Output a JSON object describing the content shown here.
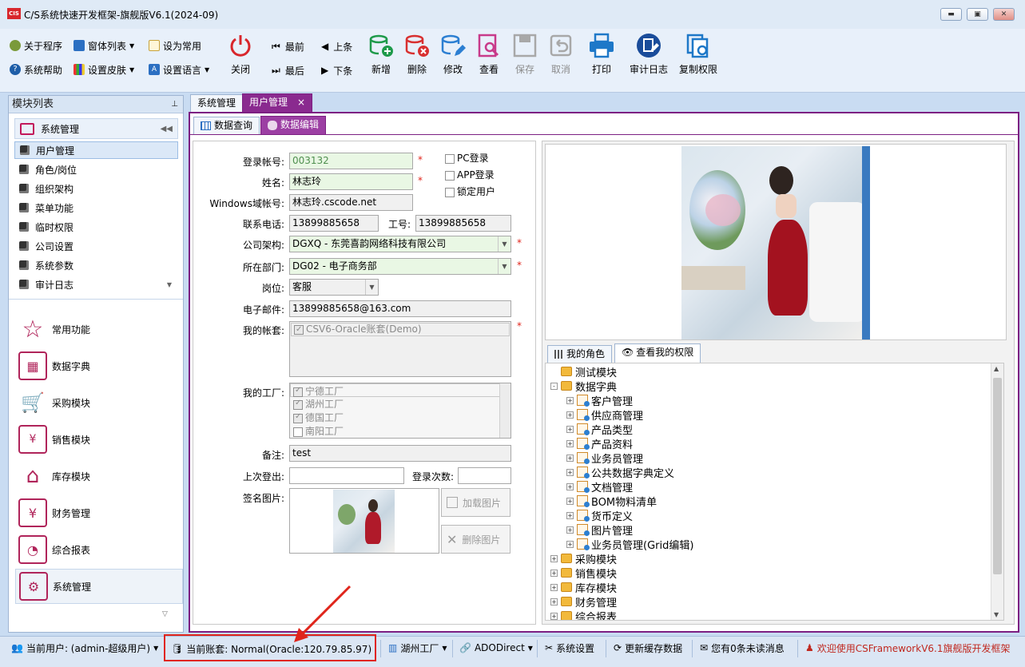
{
  "window": {
    "title": "C/S系统快速开发框架-旗舰版V6.1(2024-09)",
    "logo_text": "CIS"
  },
  "ribbon": {
    "small_buttons": [
      {
        "label": "关于程序",
        "icon": "about-icon"
      },
      {
        "label": "窗体列表",
        "icon": "windows-icon"
      },
      {
        "label": "设为常用",
        "icon": "pin-icon"
      },
      {
        "label": "系统帮助",
        "icon": "help-icon"
      },
      {
        "label": "设置皮肤",
        "icon": "skin-icon"
      },
      {
        "label": "设置语言",
        "icon": "language-icon"
      }
    ],
    "close_label": "关闭",
    "nav": {
      "first": "最前",
      "prev": "上条",
      "last": "最后",
      "next": "下条"
    },
    "big_buttons": [
      {
        "label": "新增",
        "icon": "add-db-icon",
        "color": "#1e9a4a"
      },
      {
        "label": "删除",
        "icon": "delete-db-icon",
        "color": "#d83030"
      },
      {
        "label": "修改",
        "icon": "edit-db-icon",
        "color": "#2c7fd2"
      },
      {
        "label": "查看",
        "icon": "view-doc-icon",
        "color": "#c83a8a"
      },
      {
        "label": "保存",
        "icon": "save-icon",
        "color": "#a0a0a0"
      },
      {
        "label": "取消",
        "icon": "undo-icon",
        "color": "#a0a0a0"
      },
      {
        "label": "打印",
        "icon": "print-icon",
        "color": "#1e78c8"
      },
      {
        "label": "审计日志",
        "icon": "audit-icon",
        "color": "#1a4c9a"
      },
      {
        "label": "复制权限",
        "icon": "copy-perm-icon",
        "color": "#1e78c8"
      }
    ]
  },
  "left_panel": {
    "title": "模块列表",
    "group_title": "系统管理",
    "items": [
      "用户管理",
      "角色/岗位",
      "组织架构",
      "菜单功能",
      "临时权限",
      "公司设置",
      "系统参数",
      "审计日志"
    ],
    "modules": [
      {
        "label": "常用功能",
        "icon": "star-icon"
      },
      {
        "label": "数据字典",
        "icon": "dictionary-icon"
      },
      {
        "label": "采购模块",
        "icon": "cart-icon"
      },
      {
        "label": "销售模块",
        "icon": "sales-bag-icon"
      },
      {
        "label": "库存模块",
        "icon": "warehouse-icon"
      },
      {
        "label": "财务管理",
        "icon": "finance-icon"
      },
      {
        "label": "综合报表",
        "icon": "report-icon"
      },
      {
        "label": "系统管理",
        "icon": "system-admin-icon"
      }
    ]
  },
  "tabs": {
    "system": "系统管理",
    "user": "用户管理",
    "close": "×",
    "sub_query": "数据查询",
    "sub_edit": "数据编辑"
  },
  "form": {
    "login_label": "登录帐号:",
    "login_value": "003132",
    "name_label": "姓名:",
    "name_value": "林志玲",
    "windows_label": "Windows域帐号:",
    "windows_value": "林志玲.cscode.net",
    "phone_label": "联系电话:",
    "phone_value": "13899885658",
    "empno_label": "工号:",
    "empno_value": "13899885658",
    "company_label": "公司架构:",
    "company_value": "DGXQ - 东莞喜韵网络科技有限公司",
    "dept_label": "所在部门:",
    "dept_value": "DG02 - 电子商务部",
    "post_label": "岗位:",
    "post_value": "客服",
    "email_label": "电子邮件:",
    "email_value": "13899885658@163.com",
    "account_label": "我的帐套:",
    "account_value": "CSV6-Oracle账套(Demo)",
    "factory_label": "我的工厂:",
    "factories": [
      {
        "label": "宁德工厂",
        "checked": true
      },
      {
        "label": "湖州工厂",
        "checked": true
      },
      {
        "label": "德国工厂",
        "checked": true
      },
      {
        "label": "南阳工厂",
        "checked": false
      }
    ],
    "remark_label": "备注:",
    "remark_value": "test",
    "lastlogout_label": "上次登出:",
    "lastlogout_value": "",
    "logincount_label": "登录次数:",
    "logincount_value": "",
    "sign_label": "签名图片:",
    "load_image": "加载图片",
    "delete_image": "删除图片",
    "pc_login": "PC登录",
    "app_login": "APP登录",
    "lock_user": "锁定用户",
    "required_mark": "*"
  },
  "perm_tabs": {
    "roles": "我的角色",
    "perms": "查看我的权限"
  },
  "permissions": [
    {
      "label": "测试模块",
      "level": 0,
      "type": "box",
      "fold": ""
    },
    {
      "label": "数据字典",
      "level": 0,
      "type": "box",
      "fold": "-"
    },
    {
      "label": "客户管理",
      "level": 1,
      "type": "doc",
      "fold": "+"
    },
    {
      "label": "供应商管理",
      "level": 1,
      "type": "doc",
      "fold": "+"
    },
    {
      "label": "产品类型",
      "level": 1,
      "type": "doc",
      "fold": "+"
    },
    {
      "label": "产品资料",
      "level": 1,
      "type": "doc",
      "fold": "+"
    },
    {
      "label": "业务员管理",
      "level": 1,
      "type": "doc",
      "fold": "+"
    },
    {
      "label": "公共数据字典定义",
      "level": 1,
      "type": "doc",
      "fold": "+"
    },
    {
      "label": "文档管理",
      "level": 1,
      "type": "doc",
      "fold": "+"
    },
    {
      "label": "BOM物料清单",
      "level": 1,
      "type": "doc",
      "fold": "+"
    },
    {
      "label": "货币定义",
      "level": 1,
      "type": "doc",
      "fold": "+"
    },
    {
      "label": "图片管理",
      "level": 1,
      "type": "doc",
      "fold": "+"
    },
    {
      "label": "业务员管理(Grid编辑)",
      "level": 1,
      "type": "doc",
      "fold": "+"
    },
    {
      "label": "采购模块",
      "level": 0,
      "type": "box",
      "fold": "+"
    },
    {
      "label": "销售模块",
      "level": 0,
      "type": "box",
      "fold": "+"
    },
    {
      "label": "库存模块",
      "level": 0,
      "type": "box",
      "fold": "+"
    },
    {
      "label": "财务管理",
      "level": 0,
      "type": "box",
      "fold": "+"
    },
    {
      "label": "综合报表",
      "level": 0,
      "type": "box",
      "fold": "+"
    }
  ],
  "statusbar": {
    "user": "当前用户: (admin-超级用户)",
    "account": "当前账套: Normal(Oracle:120.79.85.97)",
    "factory": "湖州工厂",
    "ado": "ADODirect",
    "settings": "系统设置",
    "cache": "更新缓存数据",
    "messages": "您有0条未读消息",
    "welcome": "欢迎使用CSFrameworkV6.1旗舰版开发框架"
  },
  "colors": {
    "accent": "#7c1f82",
    "highlight": "#e0251b",
    "tab_bg": "#8a2a8f"
  }
}
